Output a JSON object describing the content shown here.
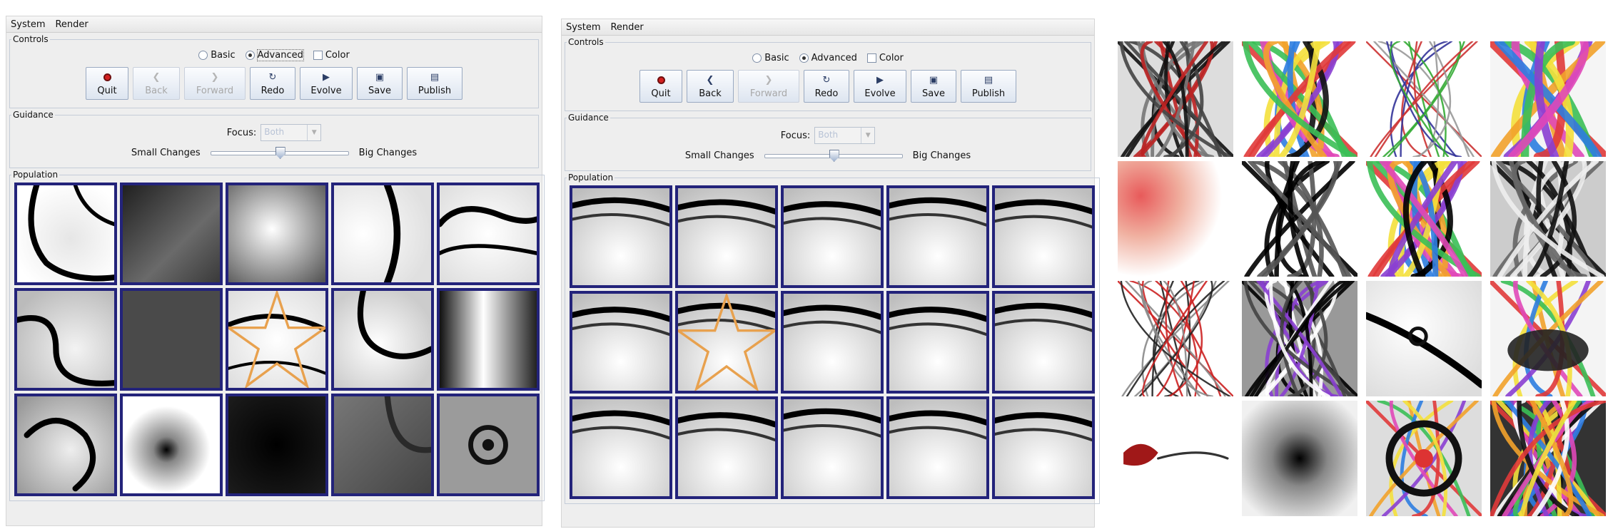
{
  "windows": [
    {
      "menu": [
        "System",
        "Render"
      ],
      "controls_legend": "Controls",
      "modes": [
        {
          "label": "Basic",
          "type": "radio",
          "checked": false
        },
        {
          "label": "Advanced",
          "type": "radio",
          "checked": true
        },
        {
          "label": "Color",
          "type": "checkbox",
          "checked": false
        }
      ],
      "buttons": [
        {
          "label": "Quit",
          "icon": "quit-icon",
          "enabled": true
        },
        {
          "label": "Back",
          "icon": "back-icon",
          "enabled": false
        },
        {
          "label": "Forward",
          "icon": "forward-icon",
          "enabled": false
        },
        {
          "label": "Redo",
          "icon": "redo-icon",
          "enabled": true
        },
        {
          "label": "Evolve",
          "icon": "play-icon",
          "enabled": true
        },
        {
          "label": "Save",
          "icon": "save-icon",
          "enabled": true
        },
        {
          "label": "Publish",
          "icon": "publish-icon",
          "enabled": true
        }
      ],
      "guidance_legend": "Guidance",
      "focus_label": "Focus:",
      "focus_value": "Both",
      "slider_left": "Small Changes",
      "slider_right": "Big Changes",
      "slider_value": 0.5,
      "population_legend": "Population",
      "starred_cell": 7
    },
    {
      "menu": [
        "System",
        "Render"
      ],
      "controls_legend": "Controls",
      "modes": [
        {
          "label": "Basic",
          "type": "radio",
          "checked": false
        },
        {
          "label": "Advanced",
          "type": "radio",
          "checked": true
        },
        {
          "label": "Color",
          "type": "checkbox",
          "checked": false
        }
      ],
      "buttons": [
        {
          "label": "Quit",
          "icon": "quit-icon",
          "enabled": true
        },
        {
          "label": "Back",
          "icon": "back-icon",
          "enabled": true
        },
        {
          "label": "Forward",
          "icon": "forward-icon",
          "enabled": false
        },
        {
          "label": "Redo",
          "icon": "redo-icon",
          "enabled": true
        },
        {
          "label": "Evolve",
          "icon": "play-icon",
          "enabled": true
        },
        {
          "label": "Save",
          "icon": "save-icon",
          "enabled": true
        },
        {
          "label": "Publish",
          "icon": "publish-icon",
          "enabled": true
        }
      ],
      "guidance_legend": "Guidance",
      "focus_label": "Focus:",
      "focus_value": "Both",
      "slider_left": "Small Changes",
      "slider_right": "Big Changes",
      "slider_value": 0.5,
      "population_legend": "Population",
      "starred_cell": 6
    }
  ],
  "colors": {
    "cell_border": "#23237a",
    "star": "#e8a14e",
    "panel_bg": "#eeeeee"
  }
}
